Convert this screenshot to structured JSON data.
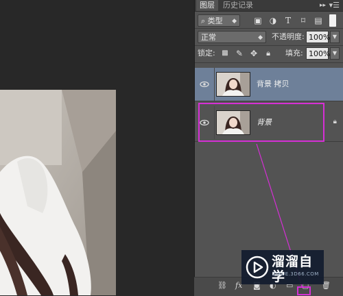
{
  "panel": {
    "tabs": [
      {
        "label": "图层",
        "active": true
      },
      {
        "label": "历史记录",
        "active": false
      }
    ],
    "filter": {
      "label": "类型",
      "icons": [
        "image-filter-icon",
        "adjustment-filter-icon",
        "type-filter-icon",
        "shape-filter-icon",
        "smart-object-filter-icon"
      ]
    },
    "blend_mode": "正常",
    "opacity_label": "不透明度:",
    "opacity_value": "100%",
    "lock_label": "锁定:",
    "fill_label": "填充:",
    "fill_value": "100%",
    "layers": [
      {
        "name": "背景 拷贝",
        "selected": true,
        "visible": true,
        "locked": false,
        "italic": false
      },
      {
        "name": "背景",
        "selected": false,
        "visible": true,
        "locked": true,
        "italic": true
      }
    ],
    "bottom_icons": [
      "link-icon",
      "fx-icon",
      "add-mask-icon",
      "new-adjustment-icon",
      "new-group-icon",
      "new-layer-icon",
      "delete-icon"
    ]
  },
  "watermark": {
    "title": "溜溜自学",
    "url": "ZIXUE.3D66.COM"
  },
  "colors": {
    "panel_bg": "#535353",
    "selected_layer": "#6e8099",
    "highlight": "#d62fd6",
    "canvas_bg": "#282828"
  }
}
